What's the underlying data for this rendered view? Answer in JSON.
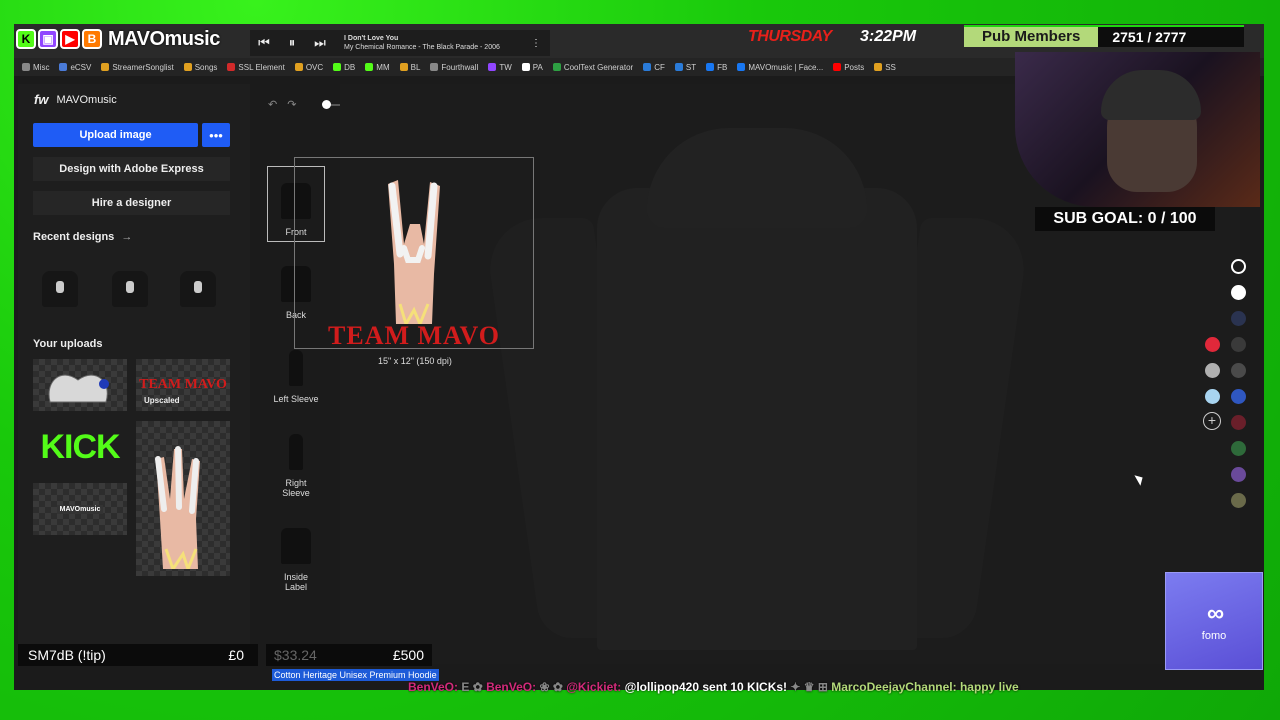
{
  "overlay": {
    "brand": "MAVOmusic",
    "day": "THURSDAY",
    "time": "3:22PM",
    "pub_members_label": "Pub Members",
    "pub_members_count": "2751 / 2777",
    "sub_goal": "SUB GOAL: 0 / 100",
    "tip_label": "SM7dB (!tip)",
    "tip_current": "£0",
    "tip_goal_current": "$33.24",
    "tip_goal_max": "£500",
    "fomo_label": "fomo",
    "ticker": [
      "BenVeO:",
      "BenVeO:",
      "@Kickiet:",
      "@lollipop420 sent 10 KICKs!",
      "MarcoDeejayChannel: happy live"
    ]
  },
  "player": {
    "track_title": "I Don't Love You",
    "track_artist": "My Chemical Romance - The Black Parade - 2006"
  },
  "bookmarks": [
    {
      "label": "Misc",
      "color": "#888888"
    },
    {
      "label": "eCSV",
      "color": "#4a7bd8"
    },
    {
      "label": "StreamerSonglist",
      "color": "#e0a020"
    },
    {
      "label": "Songs",
      "color": "#e0a020"
    },
    {
      "label": "SSL Element",
      "color": "#d22a2a"
    },
    {
      "label": "OVC",
      "color": "#e0a020"
    },
    {
      "label": "DB",
      "color": "#53fc18"
    },
    {
      "label": "MM",
      "color": "#53fc18"
    },
    {
      "label": "BL",
      "color": "#e0a020"
    },
    {
      "label": "Fourthwall",
      "color": "#888888"
    },
    {
      "label": "TW",
      "color": "#9146ff"
    },
    {
      "label": "PA",
      "color": "#ffffff"
    },
    {
      "label": "CoolText Generator",
      "color": "#2ea043"
    },
    {
      "label": "CF",
      "color": "#2a7bd8"
    },
    {
      "label": "ST",
      "color": "#2a7bd8"
    },
    {
      "label": "FB",
      "color": "#1877f2"
    },
    {
      "label": "MAVOmusic | Face...",
      "color": "#1877f2"
    },
    {
      "label": "Posts",
      "color": "#ff0000"
    },
    {
      "label": "SS",
      "color": "#e0a020"
    }
  ],
  "sidebar": {
    "brand_short": "fw",
    "brand_name": "MAVOmusic",
    "upload_label": "Upload image",
    "more_label": "•••",
    "adobe_label": "Design with Adobe Express",
    "hire_label": "Hire a designer",
    "recent_label": "Recent designs",
    "recent_arrow": "→",
    "uploads_label": "Your uploads",
    "upscaled_label": "Upscaled",
    "kick_label": "KICK",
    "team_label": "TEAM MAVO",
    "mini_logo_label": "MAVOmusic"
  },
  "views": [
    {
      "label": "Front"
    },
    {
      "label": "Back"
    },
    {
      "label": "Left Sleeve"
    },
    {
      "label": "Right Sleeve"
    },
    {
      "label": "Inside Label"
    }
  ],
  "canvas": {
    "print_text": "TEAM MAVO",
    "dpi_label": "15\" x 12\" (150 dpi)"
  },
  "product": {
    "name": "Cotton Heritage Unisex Premium Hoodie"
  },
  "swatches": [
    {
      "color": "#1c1c1c"
    },
    {
      "color": "#ffffff"
    },
    {
      "color": "#2a3350"
    },
    {
      "color": "#e0283a"
    },
    {
      "color": "#3a3a3a"
    },
    {
      "color": "#b0b0b0"
    },
    {
      "color": "#4a4a4a"
    },
    {
      "color": "#a8d4f0"
    },
    {
      "color": "#2f57c0"
    },
    {
      "color": "#6a1f2a"
    },
    {
      "color": "#2e6a3a"
    },
    {
      "color": "#6a4a9a"
    },
    {
      "color": "#6a6a4a"
    }
  ]
}
